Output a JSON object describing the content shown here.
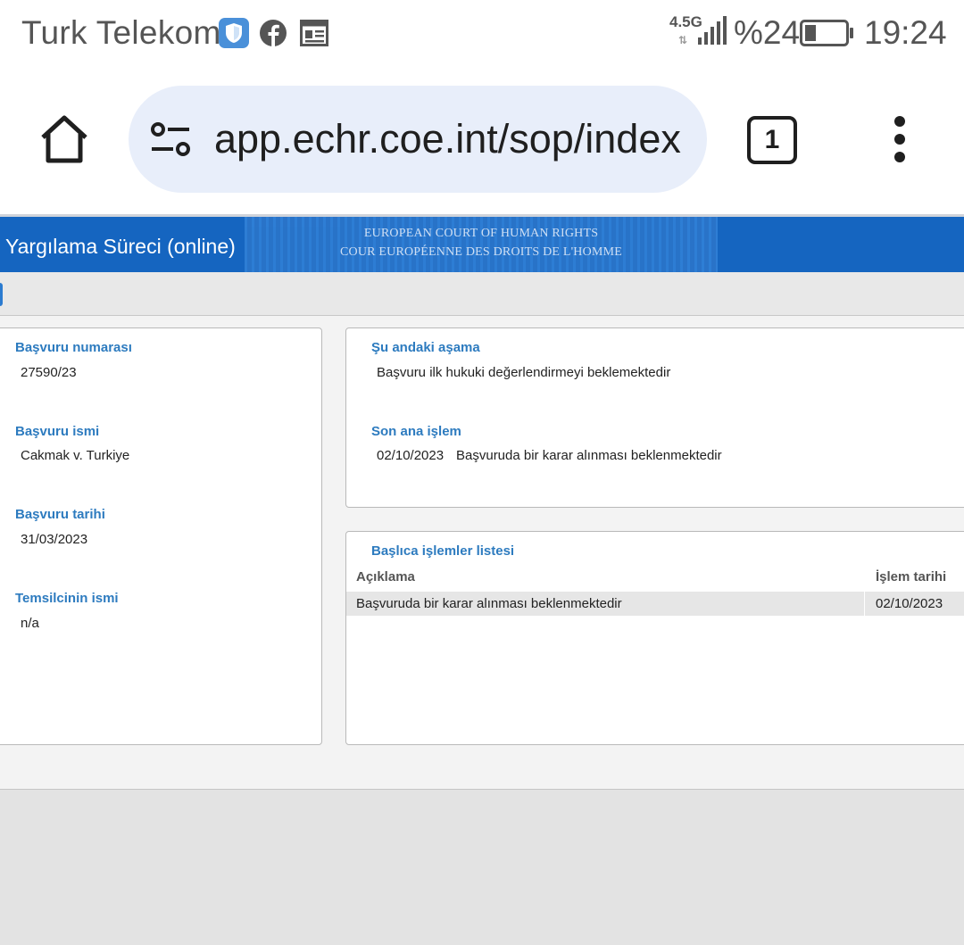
{
  "status_bar": {
    "carrier": "Turk Telekom",
    "network": "4.5G",
    "battery": "%24",
    "time": "19:24",
    "icons": [
      "shield-icon",
      "facebook-icon",
      "news-icon",
      "signal-icon",
      "battery-icon"
    ]
  },
  "browser": {
    "url": "app.echr.coe.int/sop/index",
    "tab_count": "1"
  },
  "header": {
    "title": "Yargılama Süreci (online)",
    "banner_line1": "EUROPEAN COURT OF HUMAN RIGHTS",
    "banner_line2": "COUR EUROPÉENNE DES DROITS DE L'HOMME"
  },
  "left_panel": {
    "fields": [
      {
        "label": "Başvuru numarası",
        "value": "27590/23"
      },
      {
        "label": "Başvuru ismi",
        "value": "Cakmak v. Turkiye"
      },
      {
        "label": "Başvuru tarihi",
        "value": "31/03/2023"
      },
      {
        "label": "Temsilcinin ismi",
        "value": "n/a"
      }
    ]
  },
  "status_panel": {
    "stage_label": "Şu andaki aşama",
    "stage_value": "Başvuru ilk hukuki değerlendirmeyi beklemektedir",
    "last_action_label": "Son ana işlem",
    "last_action_date": "02/10/2023",
    "last_action_text": "Başvuruda bir karar alınması beklenmektedir"
  },
  "actions_panel": {
    "title": "Başlıca işlemler listesi",
    "columns": [
      "Açıklama",
      "İşlem tarihi"
    ],
    "rows": [
      {
        "description": "Başvuruda bir karar alınması beklenmektedir",
        "date": "02/10/2023"
      }
    ]
  },
  "colors": {
    "header_blue": "#1565c0",
    "label_blue": "#2d7bbf",
    "url_pill": "#e8eefa"
  }
}
